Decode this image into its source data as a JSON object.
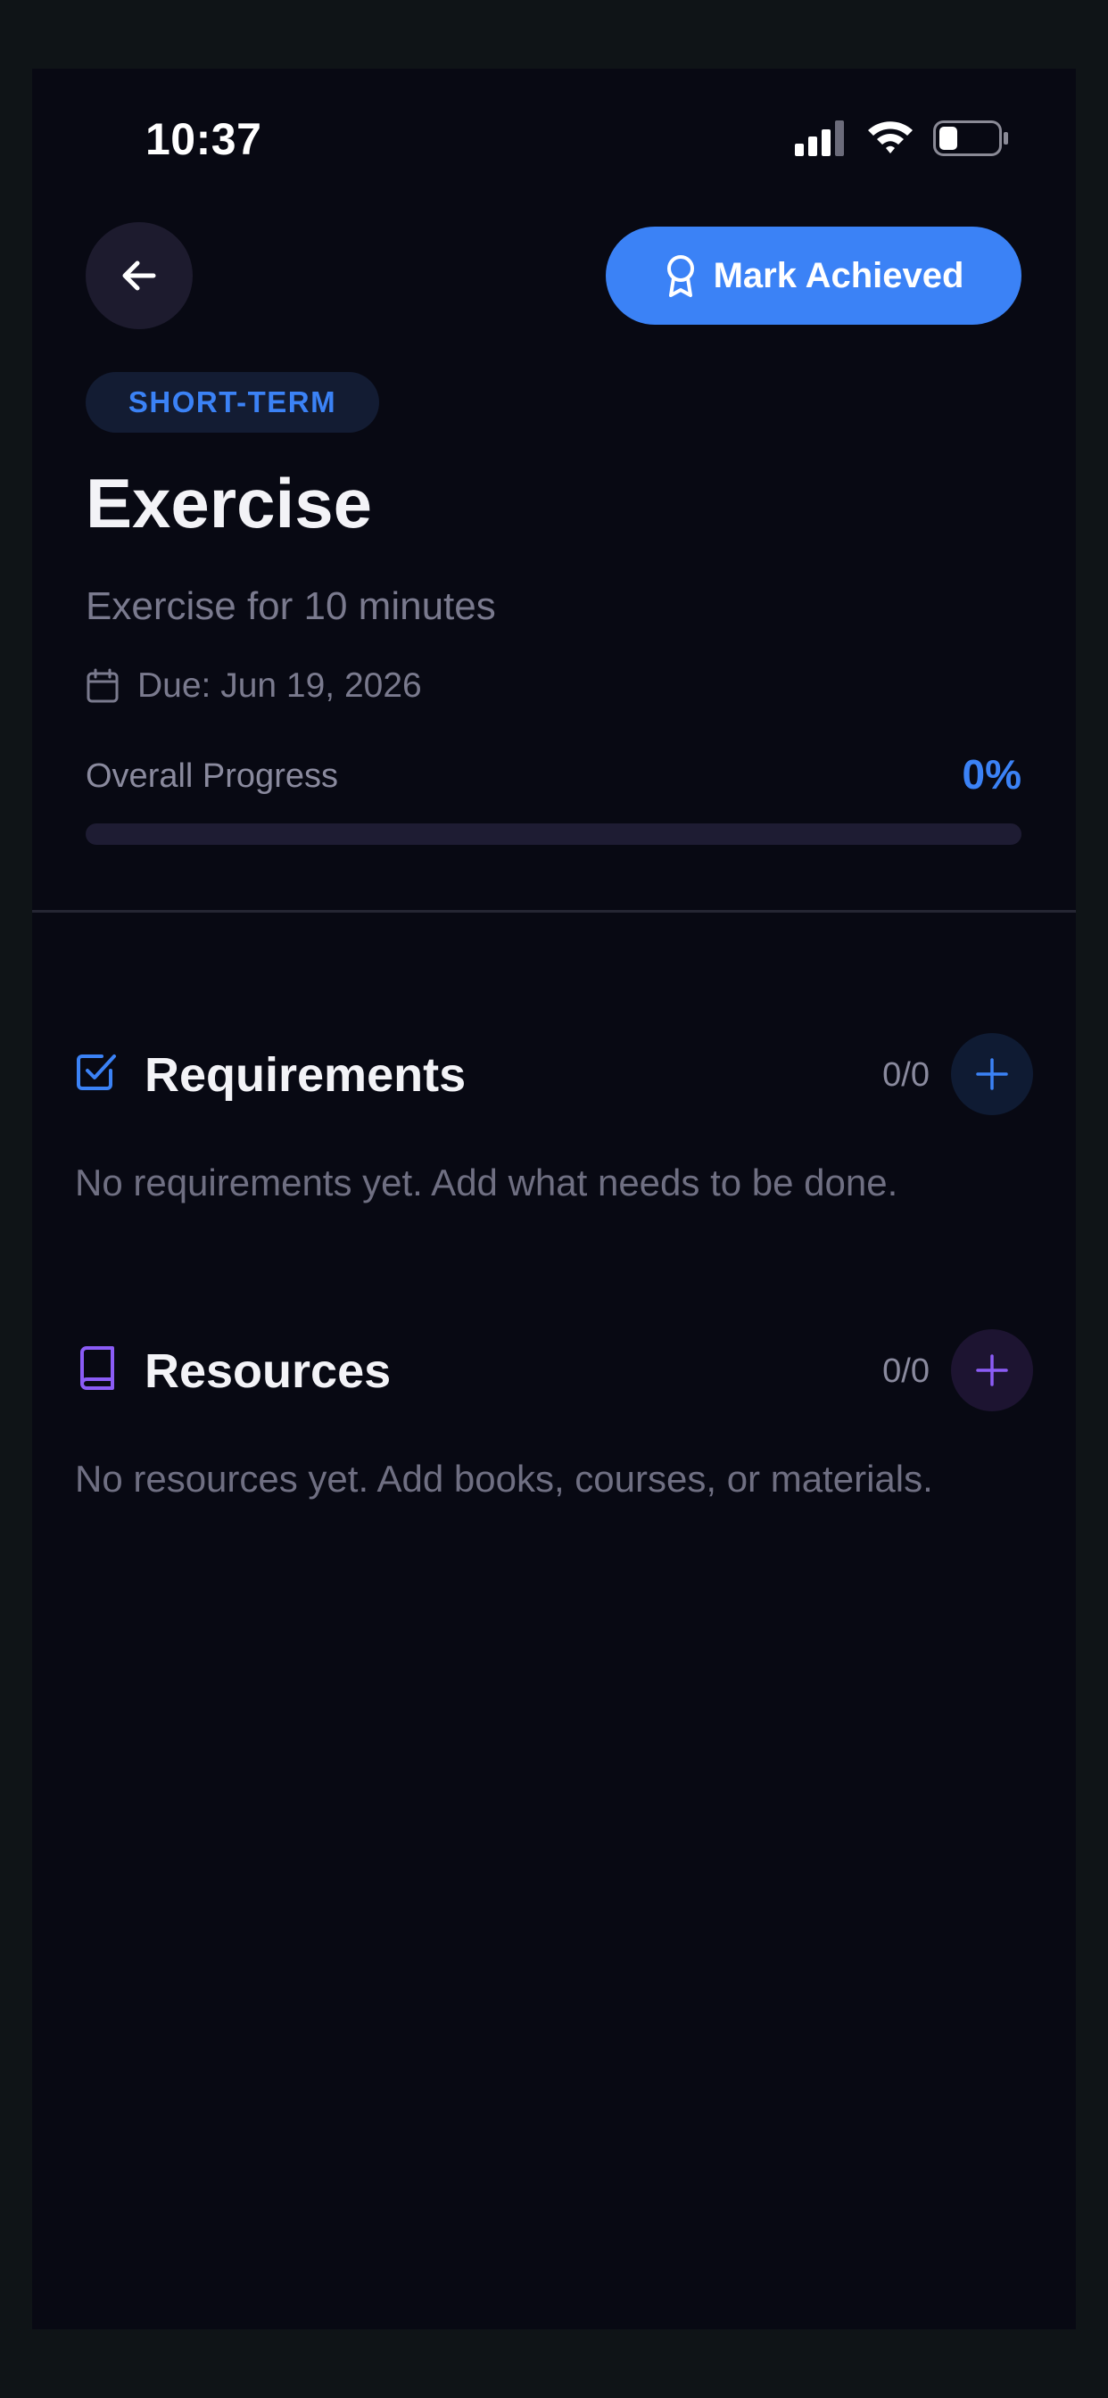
{
  "status_bar": {
    "time": "10:37",
    "icons": [
      "signal-icon",
      "wifi-icon",
      "battery-icon"
    ]
  },
  "header": {
    "back_icon": "arrow-left-icon",
    "achieve_button": {
      "label": "Mark Achieved",
      "icon": "award-ribbon-icon"
    }
  },
  "goal": {
    "category": "SHORT-TERM",
    "title": "Exercise",
    "description": "Exercise for 10 minutes",
    "due_icon": "calendar-icon",
    "due": "Due: Jun 19, 2026"
  },
  "progress": {
    "label": "Overall Progress",
    "value_text": "0%",
    "value": 0
  },
  "sections": {
    "requirements": {
      "icon": "checkbox-checked-icon",
      "title": "Requirements",
      "count": "0/0",
      "empty_text": "No requirements yet. Add what needs to be done."
    },
    "resources": {
      "icon": "book-icon",
      "title": "Resources",
      "count": "0/0",
      "empty_text": "No resources yet. Add books, courses, or materials."
    }
  },
  "colors": {
    "background": "#080913",
    "accent_blue": "#3b82f6",
    "accent_purple": "#8b5cf6",
    "text_primary": "#f3f3f7",
    "text_muted": "#7a7a8e"
  }
}
